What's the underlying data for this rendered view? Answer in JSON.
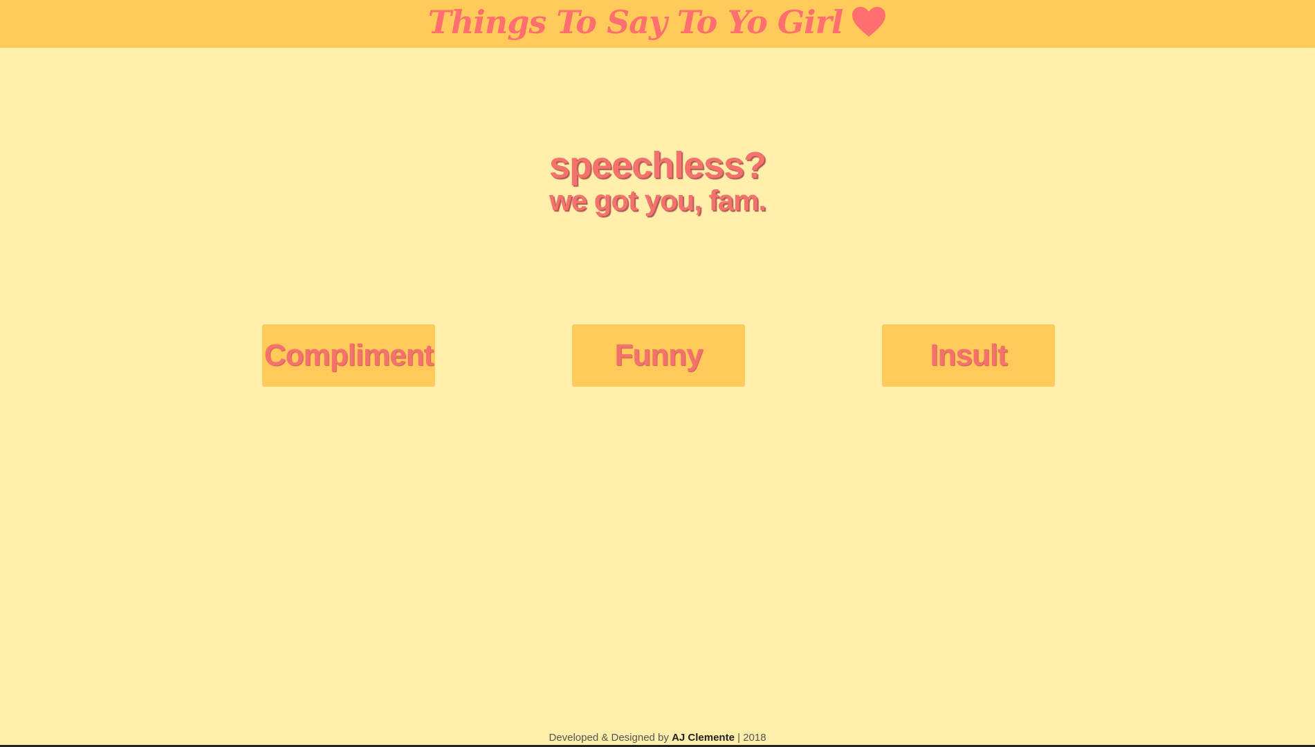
{
  "header": {
    "title": "Things To Say To Yo Girl",
    "icon": "heart-icon",
    "background_color": "#FFCA5A",
    "accent_color": "#FF6F6F"
  },
  "hero": {
    "headline": "speechless?",
    "subheadline": "we got you, fam."
  },
  "categories": [
    {
      "label": "Compliment"
    },
    {
      "label": "Funny"
    },
    {
      "label": "Insult"
    }
  ],
  "footer": {
    "prefix": "Developed & Designed by ",
    "author": "AJ Clemente",
    "suffix": " | 2018"
  },
  "colors": {
    "page_background": "#FFEFAA",
    "button_background": "#FFCA5A",
    "text_accent": "#F4716C"
  }
}
